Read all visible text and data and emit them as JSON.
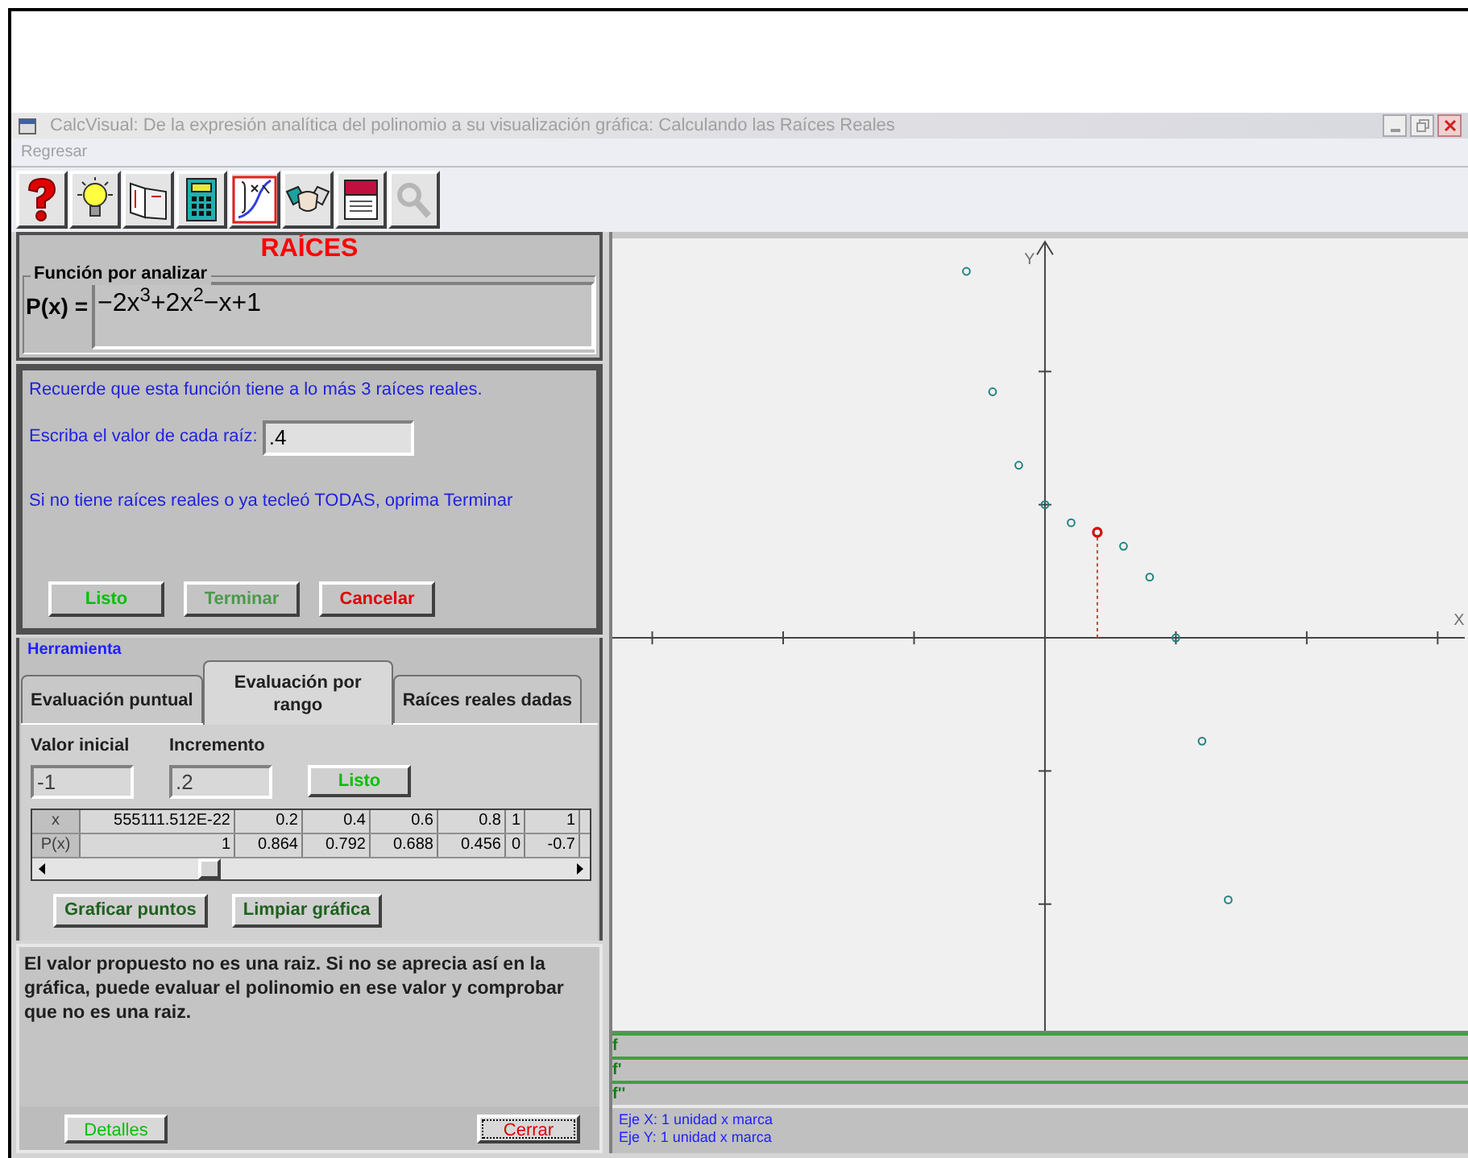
{
  "window": {
    "title": "CalcVisual: De la expresión analítica del polinomio a su visualización gráfica: Calculando las Raíces Reales",
    "menu": [
      {
        "label": "Regresar",
        "disabled": true
      }
    ]
  },
  "toolbar": [
    {
      "kind": "help",
      "disabled": false
    },
    {
      "kind": "bulb",
      "disabled": false
    },
    {
      "kind": "book",
      "disabled": false
    },
    {
      "kind": "calculator",
      "disabled": false
    },
    {
      "kind": "graph",
      "disabled": false
    },
    {
      "kind": "handshake",
      "disabled": false
    },
    {
      "kind": "notebook",
      "disabled": false
    },
    {
      "kind": "magnifier",
      "disabled": true
    }
  ],
  "roots_panel": {
    "title": "RAÍCES",
    "function_group": {
      "legend": "Función por analizar",
      "label": "P(x) =",
      "expression": "−2x$^{3}$+2x$^{2}$−x+1"
    },
    "question": {
      "note": "Recuerde que esta función tiene a lo más 3 raíces reales.",
      "prompt": "Escriba el valor de cada raíz:",
      "value": ".4",
      "hint": "Si no tiene raíces reales o ya tecleó TODAS, oprima Terminar",
      "buttons": [
        {
          "label": "Listo",
          "kind": "ok",
          "disabled": false
        },
        {
          "label": "Terminar",
          "kind": "ok",
          "disabled": true
        },
        {
          "label": "Cancelar",
          "kind": "cancel",
          "disabled": false
        }
      ]
    }
  },
  "tool": {
    "legend": "Herramienta",
    "tabs": [
      {
        "label": "Evaluación puntual",
        "selected": false
      },
      {
        "label": "Evaluación por rango",
        "selected": true
      },
      {
        "label": "Raíces reales dadas",
        "selected": false
      }
    ],
    "fields": [
      {
        "label": "Valor inicial",
        "value": "-1"
      },
      {
        "label": "Incremento",
        "value": ".2"
      }
    ],
    "apply_button": "Listo",
    "table": {
      "rows": [
        {
          "header": "x",
          "cells": [
            "555111.512E-22",
            "0.2",
            "0.4",
            "0.6",
            "0.8",
            "1",
            "1"
          ]
        },
        {
          "header": "P(x)",
          "cells": [
            "1",
            "0.864",
            "0.792",
            "0.688",
            "0.456",
            "0",
            "-0.7"
          ]
        }
      ]
    },
    "buttons": [
      "Graficar puntos",
      "Limpiar gráfica"
    ]
  },
  "message": {
    "text": "El valor propuesto no es una raiz. Si no se aprecia así en la gráfica, puede evaluar el polinomio en ese valor y comprobar que no es una raiz.",
    "buttons": [
      {
        "label": "Detalles",
        "kind": "ok",
        "focused": false
      },
      {
        "label": "Cerrar",
        "kind": "cancel",
        "focused": true
      }
    ]
  },
  "graph": {
    "y_axis_label": "Y",
    "x_axis_label": "X"
  },
  "derivative_rows": [
    "f",
    "f'",
    "f''"
  ],
  "axis_info": [
    "Eje X: 1 unidad x marca",
    "Eje Y: 1 unidad x marca"
  ]
}
